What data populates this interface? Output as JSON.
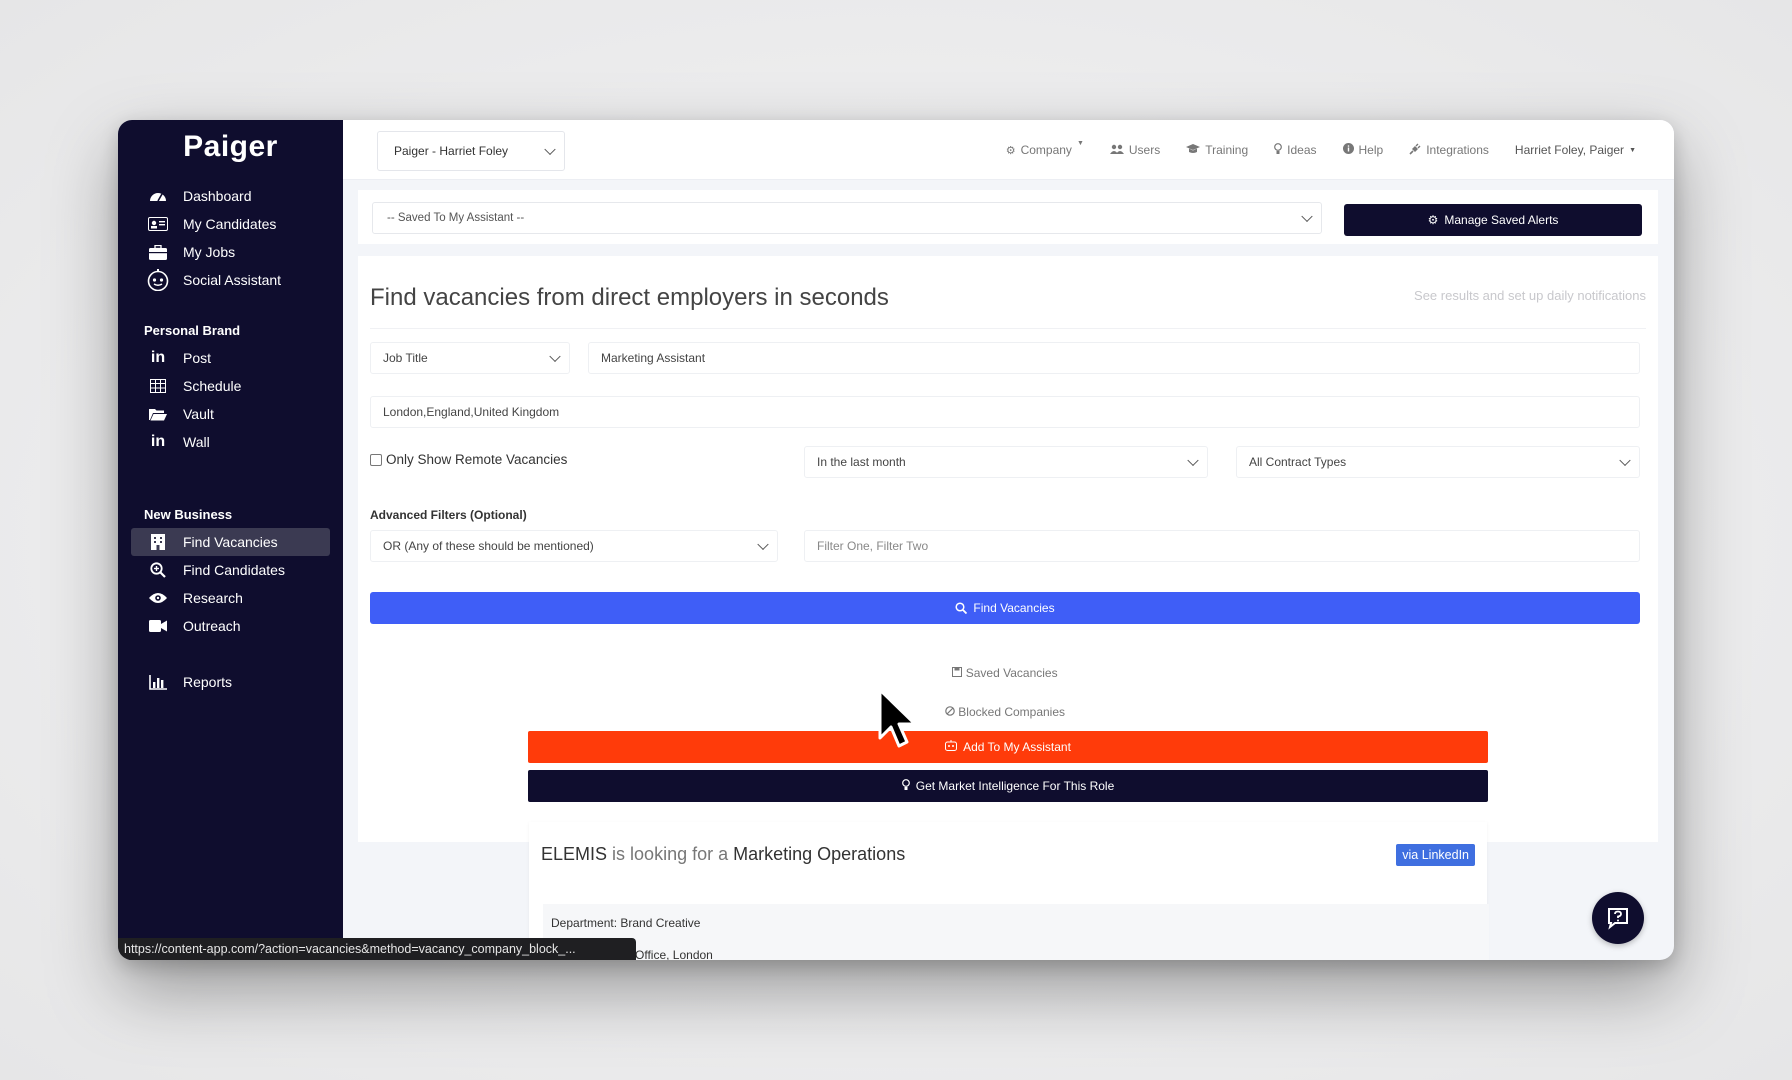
{
  "sidebar": {
    "logo": "Paiger",
    "main_items": [
      {
        "label": "Dashboard",
        "icon": "dashboard-icon"
      },
      {
        "label": "My Candidates",
        "icon": "id-card-icon"
      },
      {
        "label": "My Jobs",
        "icon": "briefcase-icon"
      },
      {
        "label": "Social Assistant",
        "icon": "robot-icon"
      }
    ],
    "personal_brand_title": "Personal Brand",
    "personal_brand_items": [
      {
        "label": "Post",
        "icon": "linkedin-icon"
      },
      {
        "label": "Schedule",
        "icon": "table-icon"
      },
      {
        "label": "Vault",
        "icon": "folder-open-icon"
      },
      {
        "label": "Wall",
        "icon": "linkedin-icon"
      }
    ],
    "new_business_title": "New Business",
    "new_business_items": [
      {
        "label": "Find Vacancies",
        "icon": "building-icon",
        "active": true
      },
      {
        "label": "Find Candidates",
        "icon": "search-plus-icon"
      },
      {
        "label": "Research",
        "icon": "eye-icon"
      },
      {
        "label": "Outreach",
        "icon": "video-icon"
      }
    ],
    "reports_item": {
      "label": "Reports",
      "icon": "bar-chart-icon"
    }
  },
  "status_url": "https://content-app.com/?action=vacancies&method=vacancy_company_block_...",
  "topbar": {
    "account_select": "Paiger - Harriet Foley",
    "links": [
      {
        "label": "Company",
        "icon": "gear-icon"
      },
      {
        "label": "Users",
        "icon": "users-icon"
      },
      {
        "label": "Training",
        "icon": "graduation-cap-icon"
      },
      {
        "label": "Ideas",
        "icon": "lightbulb-icon"
      },
      {
        "label": "Help",
        "icon": "info-icon"
      },
      {
        "label": "Integrations",
        "icon": "plug-icon"
      }
    ],
    "user_menu": "Harriet Foley, Paiger"
  },
  "saved_bar": {
    "select_value": "-- Saved To My Assistant --",
    "manage_button": "Manage Saved Alerts"
  },
  "search": {
    "heading": "Find vacancies from direct employers in seconds",
    "subheading": "See results and set up daily notifications",
    "search_type": "Job Title",
    "keyword": "Marketing Assistant",
    "location": "London,England,United Kingdom",
    "remote_label": "Only Show Remote Vacancies",
    "date_filter": "In the last month",
    "contract_filter": "All Contract Types",
    "advanced_label": "Advanced Filters (Optional)",
    "advanced_mode": "OR (Any of these should be mentioned)",
    "filter_placeholder": "Filter One, Filter Two",
    "find_button": "Find Vacancies",
    "saved_link": "Saved Vacancies",
    "blocked_link": "Blocked Companies"
  },
  "actions": {
    "add_assistant": "Add To My Assistant",
    "market_intel": "Get Market Intelligence For This Role"
  },
  "job": {
    "company": "ELEMIS",
    "connector": "is looking for a",
    "role": "Marketing Operations",
    "source": "via LinkedIn",
    "department": "Department: Brand Creative",
    "location_fragment": "Office, London"
  },
  "colors": {
    "sidebar_bg": "#0f0d2e",
    "primary_blue": "#3f5ef7",
    "accent_orange": "#ff3b0a"
  }
}
